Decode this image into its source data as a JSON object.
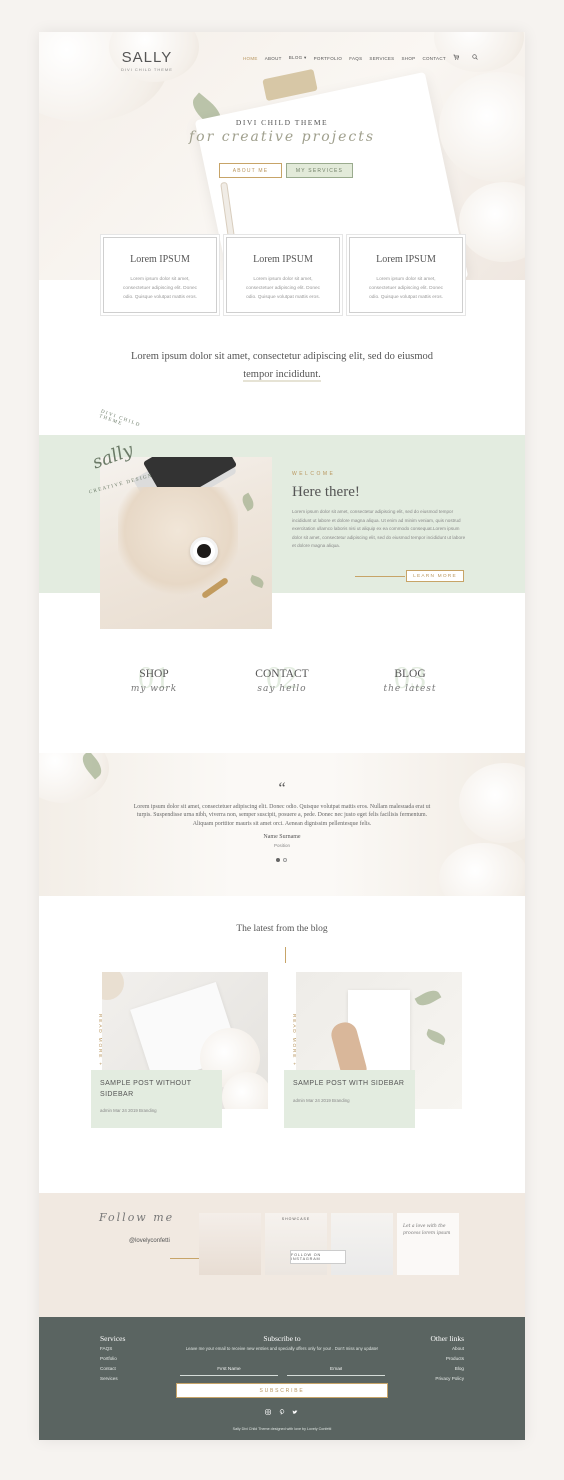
{
  "logo": {
    "name": "SALLY",
    "tagline": "DIVI CHILD THEME"
  },
  "nav": {
    "items": [
      "HOME",
      "ABOUT",
      "BLOG",
      "PORTFOLIO",
      "FAQS",
      "SERVICES",
      "SHOP",
      "CONTACT"
    ],
    "blog_suffix": "▾",
    "active": "HOME",
    "cart_icon": "cart-icon",
    "search_icon": "search-icon"
  },
  "hero": {
    "title": "DIVI CHILD THEME",
    "script": "for creative projects",
    "about_button": "ABOUT ME",
    "services_button": "MY SERVICES"
  },
  "cards": [
    {
      "title": "Lorem IPSUM",
      "text": "Lorem ipsum dolor sit amet, consectetuer adipiscing elit. Donec odio. Quisque volutpat mattis eros."
    },
    {
      "title": "Lorem IPSUM",
      "text": "Lorem ipsum dolor sit amet, consectetuer adipiscing elit. Donec odio. Quisque volutpat mattis eros."
    },
    {
      "title": "Lorem IPSUM",
      "text": "Lorem ipsum dolor sit amet, consectetuer adipiscing elit. Donec odio. Quisque volutpat mattis eros."
    }
  ],
  "intro": {
    "line1": "Lorem ipsum dolor sit amet, consectetur adipiscing elit, sed do eiusmod",
    "line2": "tempor incididunt."
  },
  "badge": {
    "top": "DIVI CHILD THEME",
    "script": "sally",
    "bottom": "CREATIVE DESIGN"
  },
  "welcome": {
    "label": "WELCOME",
    "title": "Here there!",
    "text": "Lorem ipsum dolor sit amet, consectetur adipiscing elit, sed do eiusmod tempor incididunt ut labore et dolore magna aliqua. Ut enim ad minim veniam, quis nostrud exercitation ullamco laboris nisi ut aliquip ex ea commodo consequat.Lorem ipsum dolor sit amet, consectetur adipiscing elit, sed do eiusmod tempor incididunt ut labore et dolore magna aliqua.",
    "button": "LEARN MORE"
  },
  "features": [
    {
      "num": "01",
      "label": "SHOP",
      "sub": "my work"
    },
    {
      "num": "02",
      "label": "CONTACT",
      "sub": "say hello"
    },
    {
      "num": "03",
      "label": "BLOG",
      "sub": "the latest"
    }
  ],
  "testimonial": {
    "mark": "“",
    "text": "Lorem ipsum dolor sit amet, consectetuer adipiscing elit. Donec odio. Quisque volutpat mattis eros. Nullam malesuada erat ut turpis. Suspendisse urna nibh, viverra non, semper suscipit, posuere a, pede. Donec nec justo eget felis facilisis fermentum. Aliquam porttitor mauris sit amet orci. Aenean dignissim pellentesque felis.",
    "name": "Name Surname",
    "position": "Position"
  },
  "blog": {
    "title": "The latest from the blog",
    "read_more": "READ MORE +",
    "posts": [
      {
        "title": "SAMPLE POST WITHOUT SIDEBAR",
        "meta": "admin Mar 24 2019 Branding"
      },
      {
        "title": "SAMPLE POST WITH SIDEBAR",
        "meta": "admin Mar 24 2019 Branding"
      }
    ]
  },
  "instagram": {
    "follow": "Follow me",
    "handle": "@lovelyconfetti",
    "follow_button": "FOLLOW ON INSTAGRAM",
    "tile_texts": [
      "SHOWCASE",
      "Let a love with the process lorem ipsum"
    ]
  },
  "footer": {
    "services_title": "Services",
    "services": [
      "FAQS",
      "Portfolio",
      "Contact",
      "Services"
    ],
    "subscribe_title": "Subscribe to",
    "subscribe_note": "Leave me your email to receive new entries and specially offers only for you! . Don't miss any update!",
    "first_name_placeholder": "First Name",
    "email_placeholder": "Email",
    "subscribe_button": "SUBSCRIBE",
    "other_title": "Other links",
    "other": [
      "About",
      "Products",
      "Blog",
      "Privacy Policy"
    ],
    "social": [
      "instagram-icon",
      "pinterest-icon",
      "twitter-icon"
    ],
    "credit": "Sally Divi Child Theme designed with love by Lovely Confetti"
  },
  "colors": {
    "accent": "#b8955d",
    "sage": "#e3ece0",
    "footer": "#5a6461",
    "cream": "#f1e9e1"
  }
}
